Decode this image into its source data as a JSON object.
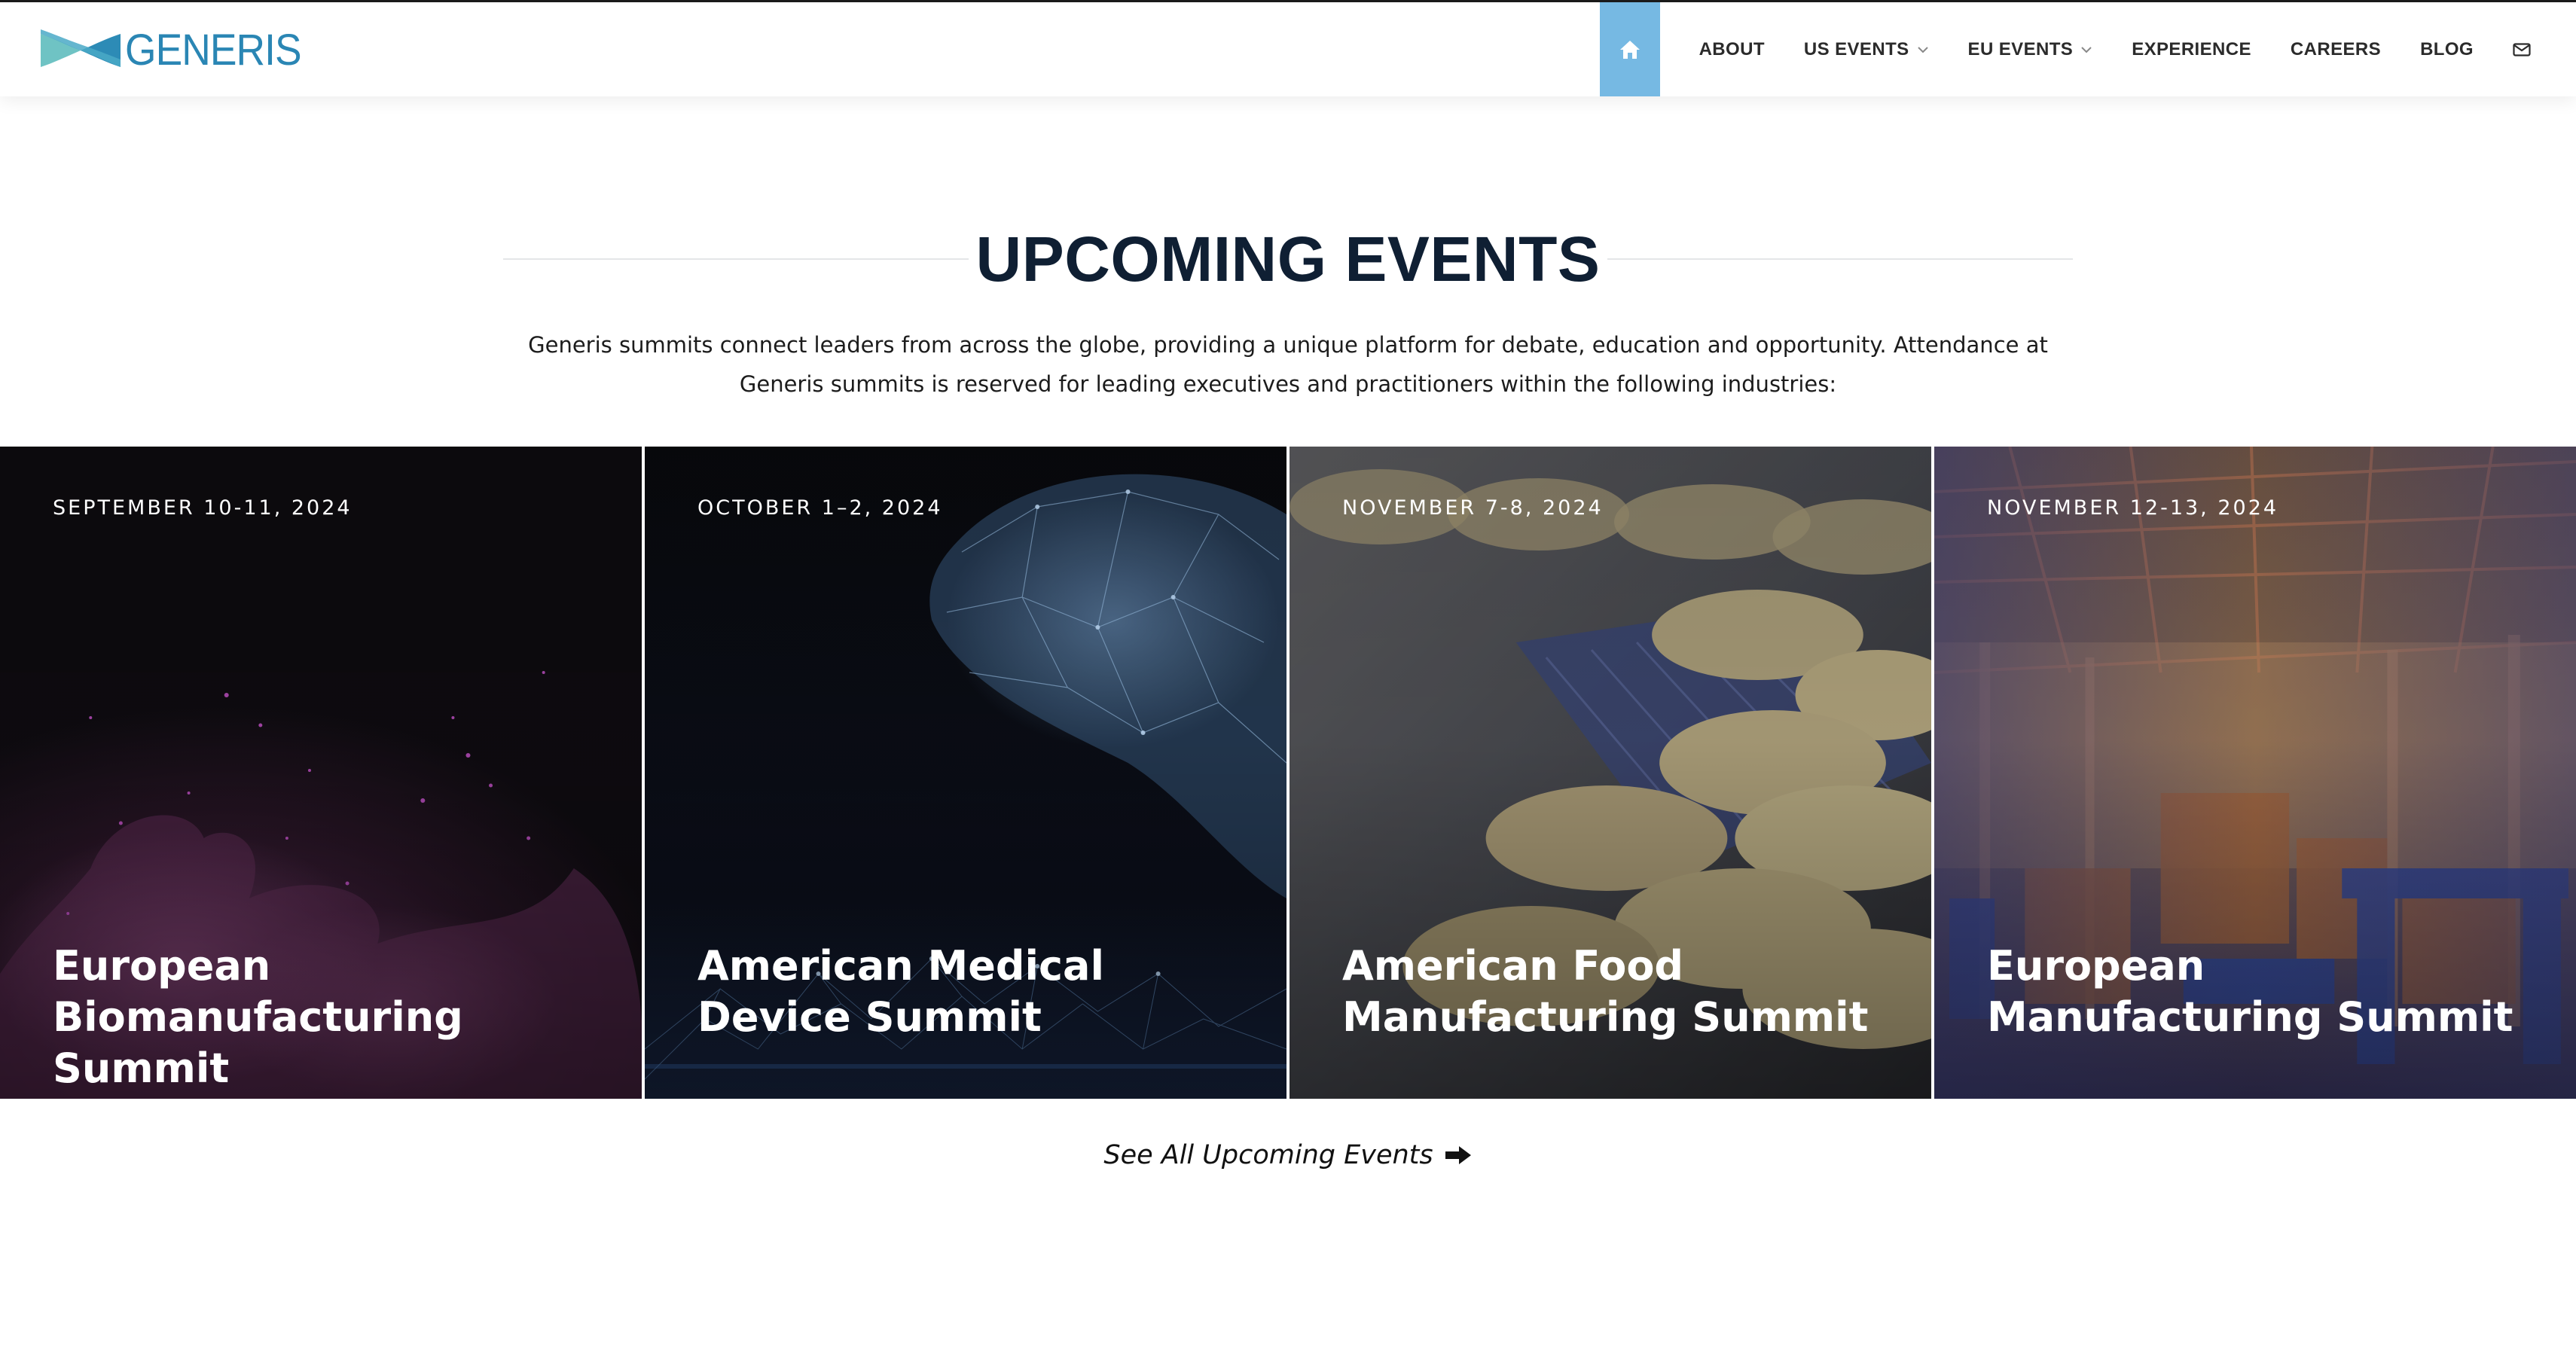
{
  "brand": {
    "logo_text": "GENERIS"
  },
  "nav": {
    "items": [
      {
        "label": "ABOUT"
      },
      {
        "label": "US EVENTS"
      },
      {
        "label": "EU EVENTS"
      },
      {
        "label": "EXPERIENCE"
      },
      {
        "label": "CAREERS"
      },
      {
        "label": "BLOG"
      }
    ],
    "home_icon": "home-icon",
    "mail_icon": "mail-icon",
    "active_color": "#76b9e3"
  },
  "main": {
    "heading": "UPCOMING EVENTS",
    "intro": "Generis summits connect leaders from across the globe, providing a unique platform for debate, education and opportunity. Attendance at Generis summits is reserved for leading executives and practitioners within the following industries:",
    "events": [
      {
        "date": "SEPTEMBER 10-11, 2024",
        "title": "European Biomanufacturing Summit",
        "image": "purple-cell-molecule"
      },
      {
        "date": "OCTOBER 1–2, 2024",
        "title": "American Medical Device Summit",
        "image": "blue-wireframe-anatomy"
      },
      {
        "date": "NOVEMBER 7-8, 2024",
        "title": "American Food Manufacturing Summit",
        "image": "crackers-conveyor"
      },
      {
        "date": "NOVEMBER 12-13, 2024",
        "title": "European Manufacturing Summit",
        "image": "factory-hall"
      }
    ],
    "see_all": "See All Upcoming Events",
    "see_all_icon": "arrow-right-icon"
  }
}
